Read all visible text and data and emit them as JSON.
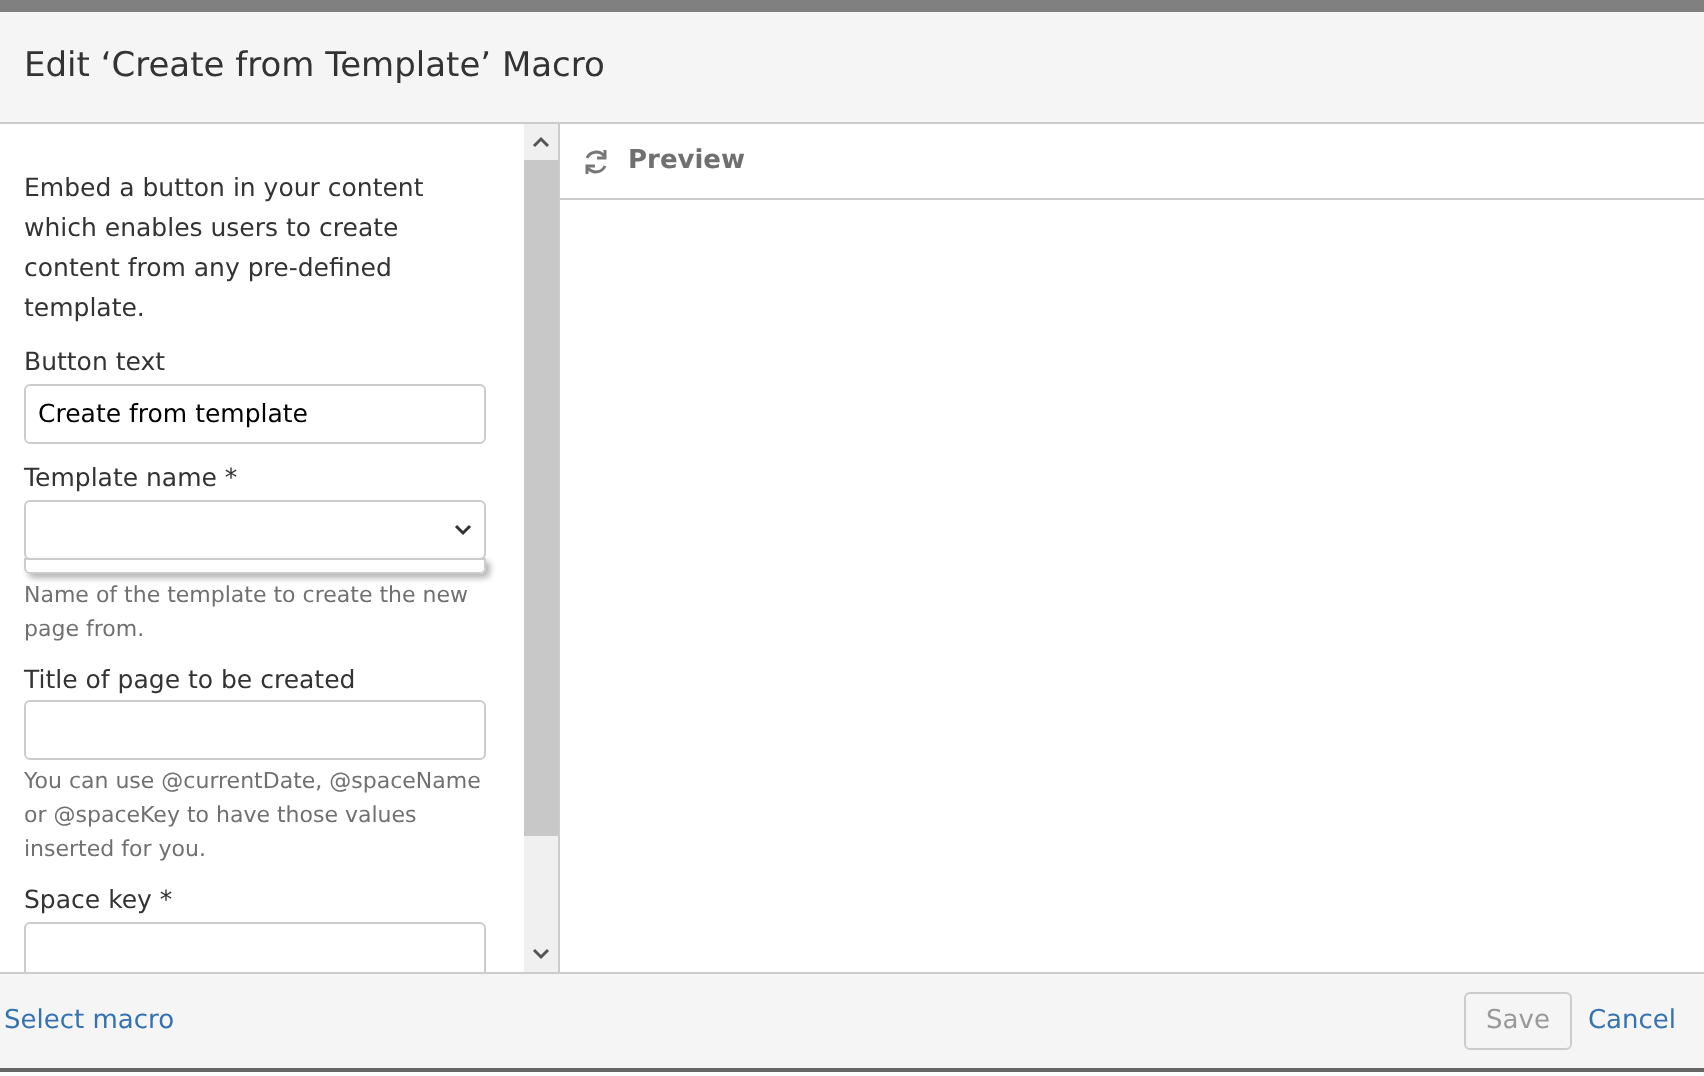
{
  "dialog": {
    "title": "Edit ‘Create from Template’ Macro"
  },
  "form": {
    "description": "Embed a button in your content which enables users to create content from any pre-defined template.",
    "fields": [
      {
        "kind": "text",
        "label": "Button text",
        "value": "Create from template"
      },
      {
        "kind": "select",
        "label": "Template name *",
        "expanded": true,
        "help": "Name of the template to create the new page from."
      },
      {
        "kind": "text",
        "label": "Title of page to be created",
        "help": "You can use @currentDate, @spaceName or @spaceKey to have those values inserted for you."
      },
      {
        "kind": "text",
        "label": "Space key *"
      }
    ]
  },
  "preview": {
    "title": "Preview"
  },
  "footer": {
    "link": "Select macro",
    "buttons": [
      {
        "label": "Save",
        "disabled": true
      },
      {
        "label": "Cancel",
        "disabled": false
      }
    ]
  }
}
